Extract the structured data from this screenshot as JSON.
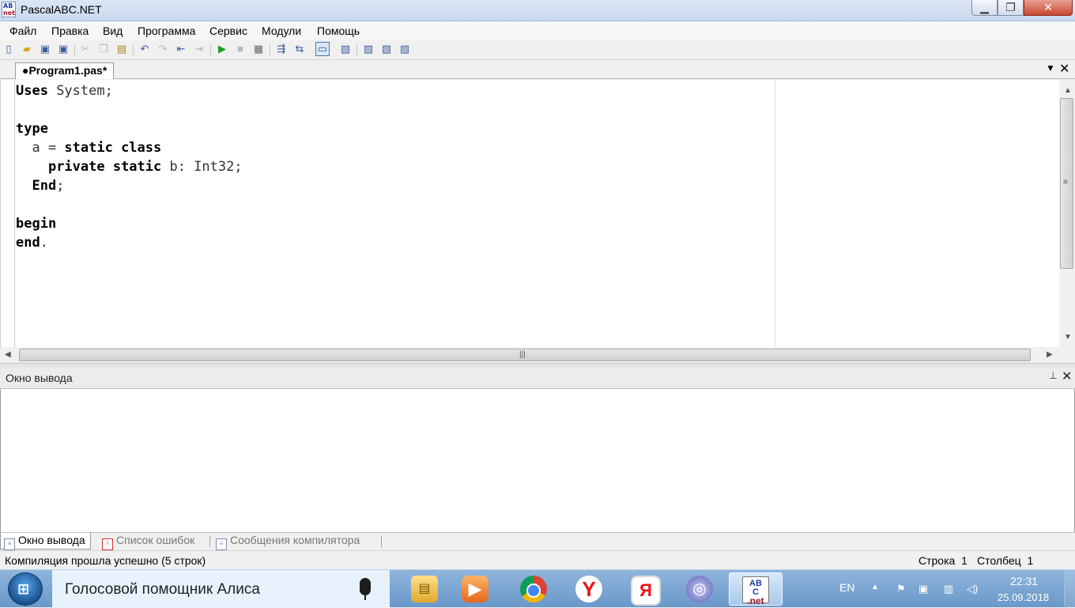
{
  "window": {
    "title": "PascalABC.NET",
    "icon_text_top": "AB",
    "icon_text_bottom": "net",
    "min_glyph": "▁",
    "max_glyph": "❐",
    "close_glyph": "✕"
  },
  "menu": {
    "items": [
      "Файл",
      "Правка",
      "Вид",
      "Программа",
      "Сервис",
      "Модули",
      "Помощь"
    ]
  },
  "toolbar": {
    "icons": [
      "new-file-icon",
      "open-icon",
      "save-icon",
      "save-all-icon",
      "cut-icon",
      "copy-icon",
      "paste-icon",
      "undo-icon",
      "redo-icon",
      "step-back-icon",
      "step-forward-icon",
      "run-icon",
      "stop-icon",
      "compile-icon",
      "format-icon",
      "indent-icon",
      "console-icon",
      "debug-icon",
      "step-into-icon",
      "step-over-icon",
      "step-out-icon"
    ]
  },
  "editor_tab": {
    "label": "●Program1.pas*",
    "dropdown_glyph": "▼",
    "close_glyph": "✕"
  },
  "code": {
    "lines": [
      [
        [
          "kw",
          "Uses"
        ],
        [
          "tx",
          " System;"
        ]
      ],
      [],
      [
        [
          "kw",
          "type"
        ]
      ],
      [
        [
          "tx",
          "  a = "
        ],
        [
          "kw",
          "static class"
        ]
      ],
      [
        [
          "tx",
          "    "
        ],
        [
          "kw",
          "private static"
        ],
        [
          "tx",
          " b: Int32;"
        ]
      ],
      [
        [
          "tx",
          "  "
        ],
        [
          "kw",
          "End"
        ],
        [
          "tx",
          ";"
        ]
      ],
      [],
      [
        [
          "kw",
          "begin"
        ]
      ],
      [
        [
          "kw",
          "end"
        ],
        [
          "tx",
          "."
        ]
      ]
    ]
  },
  "scroll": {
    "up": "▲",
    "down": "▼",
    "left": "◀",
    "right": "▶",
    "grip_v": "≡",
    "grip_h": "|||"
  },
  "output_panel": {
    "title": "Окно вывода",
    "pin_glyph": "📌",
    "close_glyph": "✕"
  },
  "bottom_tabs": [
    {
      "label": "Окно вывода",
      "active": true
    },
    {
      "label": "Список ошибок",
      "active": false
    },
    {
      "label": "Сообщения компилятора",
      "active": false
    }
  ],
  "status": {
    "message": "Компиляция прошла успешно (5 строк)",
    "row_label": "Строка  1",
    "col_label": "Столбец  1"
  },
  "taskbar": {
    "search_text": "Голосовой помощник Алиса",
    "apps": [
      {
        "name": "file-explorer",
        "glyph": "▤"
      },
      {
        "name": "media-player",
        "glyph": "▶"
      },
      {
        "name": "chrome",
        "glyph": ""
      },
      {
        "name": "yandex",
        "glyph": "Y"
      },
      {
        "name": "yandex-browser",
        "glyph": "Я"
      },
      {
        "name": "bittorrent",
        "glyph": "◎"
      },
      {
        "name": "pascalabc",
        "glyph_top": "AB",
        "glyph_mid": "C",
        "glyph_bottom": ".net"
      }
    ],
    "lang": "EN",
    "tray_arrow": "▲",
    "time": "22:31",
    "date": "25.09.2018"
  },
  "colors": {
    "accent": "#3c7fb1",
    "taskbar": "#7aa6d4"
  }
}
